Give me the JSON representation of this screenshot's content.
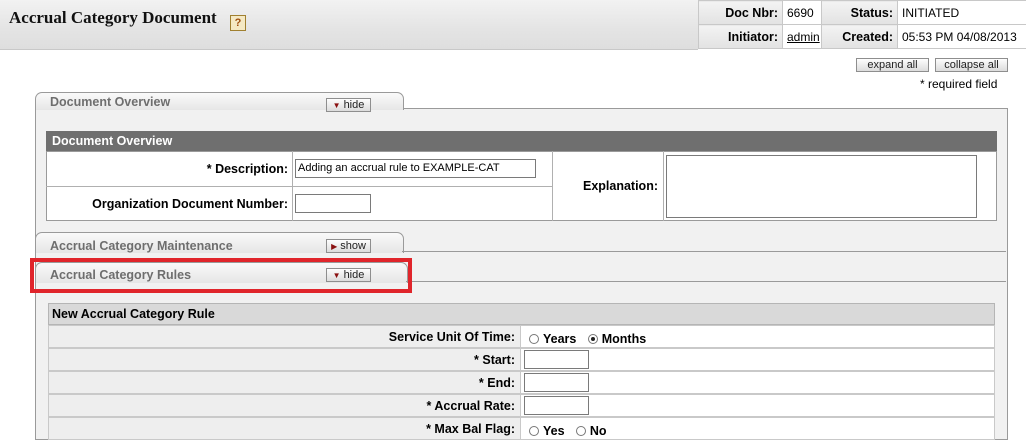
{
  "header": {
    "title": "Accrual Category Document",
    "help_glyph": "?",
    "doc_nbr_label": "Doc Nbr:",
    "doc_nbr": "6690",
    "status_label": "Status:",
    "status": "INITIATED",
    "initiator_label": "Initiator:",
    "initiator": "admin",
    "created_label": "Created:",
    "created": "05:53 PM 04/08/2013"
  },
  "controls": {
    "expand_all": "expand all",
    "collapse_all": "collapse all",
    "required_note": "* required field"
  },
  "tabs": {
    "overview": {
      "title": "Document Overview",
      "toggle": "hide"
    },
    "maintenance": {
      "title": "Accrual Category Maintenance",
      "toggle": "show"
    },
    "rules": {
      "title": "Accrual Category Rules",
      "toggle": "hide"
    }
  },
  "overview": {
    "section_title": "Document Overview",
    "description_label": "*  Description:",
    "description_value": "Adding an accrual rule to EXAMPLE-CAT",
    "org_doc_label": "Organization Document Number:",
    "org_doc_value": "",
    "explanation_label": "Explanation:",
    "explanation_value": ""
  },
  "rules": {
    "section_title": "New Accrual Category Rule",
    "rows": {
      "service_unit": {
        "label": "Service Unit Of Time:",
        "options": [
          "Years",
          "Months"
        ],
        "selected": "Months"
      },
      "start": {
        "label": "*  Start:",
        "value": ""
      },
      "end": {
        "label": "*  End:",
        "value": ""
      },
      "accrual_rate": {
        "label": "*  Accrual Rate:",
        "value": ""
      },
      "max_bal_flag": {
        "label": "*  Max Bal Flag:",
        "options": [
          "Yes",
          "No"
        ]
      }
    }
  },
  "colors": {
    "highlight": "#e0252b",
    "section_header": "#6f6f6f"
  }
}
